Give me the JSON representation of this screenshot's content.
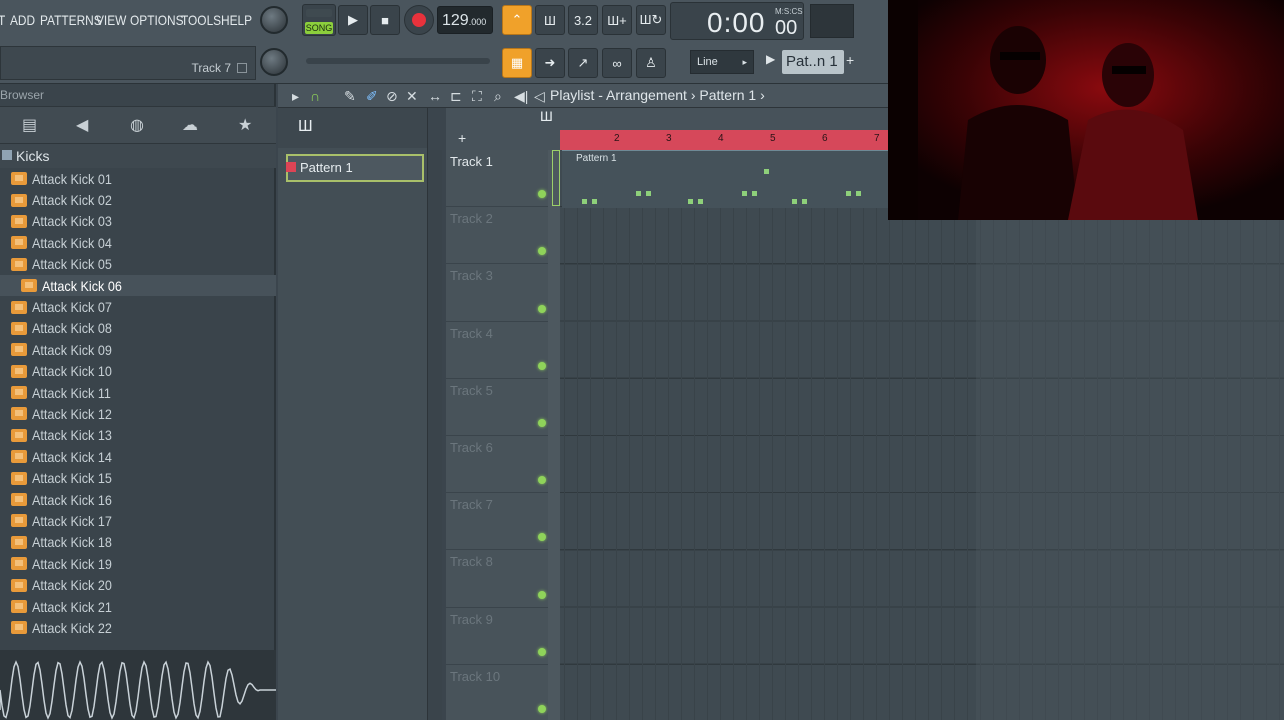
{
  "menu": [
    "T",
    "ADD",
    "PATTERNS",
    "VIEW",
    "OPTIONS",
    "TOOLS",
    "HELP"
  ],
  "hint": {
    "track": "Track 7"
  },
  "transport": {
    "song_label": "SONG",
    "tempo": "129",
    "tempo_frac": ".000"
  },
  "clock": {
    "time": "0:00",
    "label": "M:S:CS",
    "cs": "00"
  },
  "toolbar": {
    "snap": "Line",
    "pattern": "Pat..n 1",
    "btn_32": "3.2"
  },
  "browser": {
    "title": "Browser",
    "folder": "Kicks",
    "files": [
      "Attack Kick 01",
      "Attack Kick 02",
      "Attack Kick 03",
      "Attack Kick 04",
      "Attack Kick 05",
      "Attack Kick 06",
      "Attack Kick 07",
      "Attack Kick 08",
      "Attack Kick 09",
      "Attack Kick 10",
      "Attack Kick 11",
      "Attack Kick 12",
      "Attack Kick 13",
      "Attack Kick 14",
      "Attack Kick 15",
      "Attack Kick 16",
      "Attack Kick 17",
      "Attack Kick 18",
      "Attack Kick 19",
      "Attack Kick 20",
      "Attack Kick 21",
      "Attack Kick 22"
    ],
    "selected_index": 5
  },
  "playlist": {
    "breadcrumb": "Playlist - Arrangement › Pattern 1 ›",
    "pattern_item": "Pattern 1",
    "clip_label": "Pattern 1",
    "ruler": [
      "2",
      "3",
      "4",
      "5",
      "6",
      "7"
    ],
    "tracks": [
      "Track 1",
      "Track 2",
      "Track 3",
      "Track 4",
      "Track 5",
      "Track 6",
      "Track 7",
      "Track 8",
      "Track 9",
      "Track 10"
    ]
  },
  "colors": {
    "accent": "#f0a12a",
    "record": "#e8323c",
    "ruler": "#d6485a",
    "led": "#8fd35a",
    "file_icon": "#e89a3a"
  }
}
